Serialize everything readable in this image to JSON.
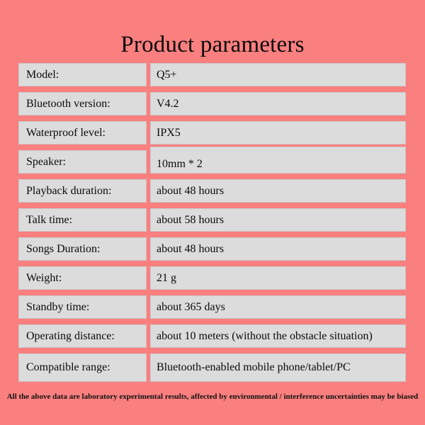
{
  "page": {
    "title": "Product parameters",
    "background_color": "#fa7f7f",
    "cell_color": "#dcdcdc",
    "text_color": "#0a0a0a"
  },
  "spec_table": {
    "rows": [
      {
        "label": "Model:",
        "value": "Q5+"
      },
      {
        "label": "Bluetooth version:",
        "value": "V4.2"
      },
      {
        "label": "Waterproof level:",
        "value": "IPX5"
      },
      {
        "label": "Speaker:",
        "value": "10mm * 2"
      },
      {
        "label": "Playback duration:",
        "value": "about 48 hours"
      },
      {
        "label": "Talk time:",
        "value": "about 58 hours"
      },
      {
        "label": "Songs Duration:",
        "value": "about 48 hours"
      },
      {
        "label": "Weight:",
        "value": "21 g"
      },
      {
        "label": "Standby time:",
        "value": "about 365 days"
      },
      {
        "label": "Operating distance:",
        "value": "about 10 meters (without the obstacle situation)"
      },
      {
        "label": "Compatible range:",
        "value": "Bluetooth-enabled mobile phone/tablet/PC"
      }
    ]
  },
  "footer": {
    "note": "All the above data are laboratory experimental results, affected by environmental / interference uncertainties may be biased"
  }
}
